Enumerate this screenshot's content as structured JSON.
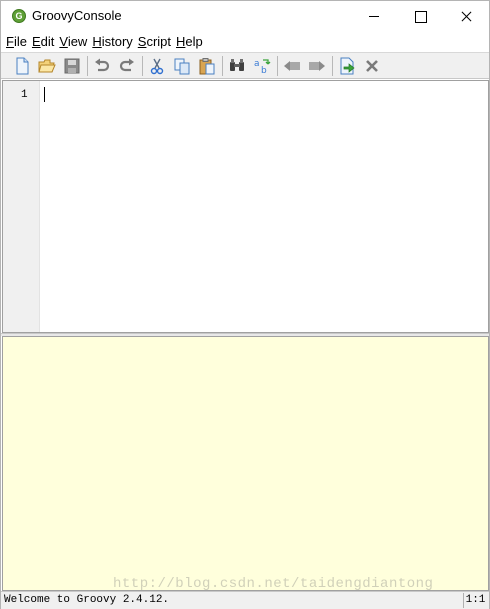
{
  "window": {
    "title": "GroovyConsole",
    "app_icon_letter": "G"
  },
  "menu": [
    {
      "mnemonic": "F",
      "rest": "ile"
    },
    {
      "mnemonic": "E",
      "rest": "dit"
    },
    {
      "mnemonic": "V",
      "rest": "iew"
    },
    {
      "mnemonic": "H",
      "rest": "istory"
    },
    {
      "mnemonic": "S",
      "rest": "cript"
    },
    {
      "mnemonic": "H",
      "rest": "elp"
    }
  ],
  "toolbar": {
    "icons": [
      "new-file-icon",
      "open-file-icon",
      "save-icon",
      "undo-icon",
      "redo-icon",
      "cut-icon",
      "copy-icon",
      "paste-icon",
      "find-icon",
      "replace-icon",
      "history-previous-icon",
      "history-next-icon",
      "run-script-icon",
      "interrupt-icon"
    ]
  },
  "editor": {
    "line_numbers": [
      "1"
    ],
    "content": ""
  },
  "output": {
    "background_color": "#ffffdc"
  },
  "status": {
    "message": "Welcome to Groovy 2.4.12.",
    "position": "1:1"
  },
  "watermark": "http://blog.csdn.net/taidengdiantong",
  "colors": {
    "editor_background": "#ffffff",
    "gutter_background": "#f0f0f0",
    "output_background": "#ffffdc"
  }
}
